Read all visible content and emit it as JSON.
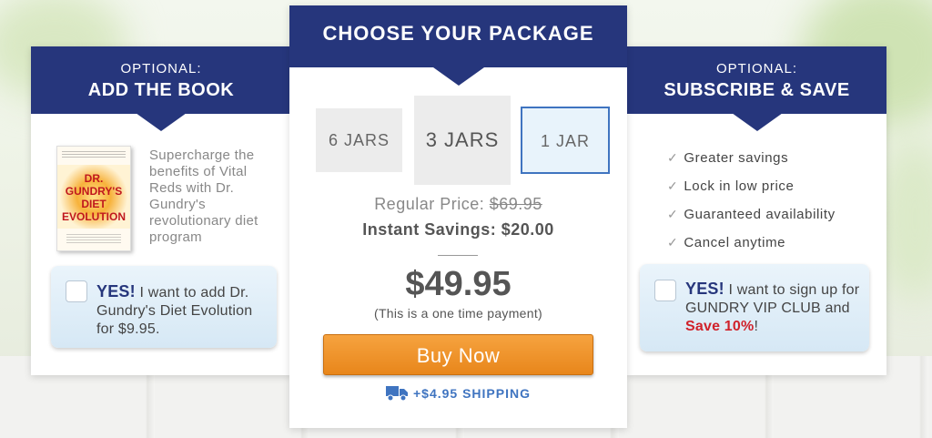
{
  "left_card": {
    "optional_label": "OPTIONAL:",
    "title": "ADD THE BOOK",
    "book_cover_title": "DR. GUNDRY'S DIET EVOLUTION",
    "description": "Supercharge the benefits of Vital Reds with Dr. Gundry's revolutionary diet program",
    "offer": {
      "yes": "YES!",
      "text": " I want to add Dr. Gundry's Diet Evolution for $9.95."
    }
  },
  "center_card": {
    "title": "CHOOSE YOUR PACKAGE",
    "packages": [
      {
        "label": "6 JARS",
        "selected": false
      },
      {
        "label": "3 JARS",
        "selected": false
      },
      {
        "label": "1 JAR",
        "selected": true
      }
    ],
    "regular_price_label": "Regular Price: ",
    "regular_price_value": "$69.95",
    "instant_savings": "Instant Savings: $20.00",
    "price": "$49.95",
    "price_note": "(This is a one time payment)",
    "buy_button": "Buy Now",
    "shipping": "+$4.95 SHIPPING",
    "shipping_icon": "truck-icon"
  },
  "right_card": {
    "optional_label": "OPTIONAL:",
    "title": "SUBSCRIBE & SAVE",
    "benefits": [
      "Greater savings",
      "Lock in low price",
      "Guaranteed availability",
      "Cancel anytime"
    ],
    "check_mark": "✓",
    "offer": {
      "yes": "YES!",
      "text_1": " I want to sign up for GUNDRY VIP CLUB and ",
      "save": "Save 10%",
      "text_2": "!"
    }
  },
  "colors": {
    "navy": "#26367c",
    "orange": "#e8861b",
    "link_blue": "#3f74c0",
    "red": "#d0222b"
  }
}
